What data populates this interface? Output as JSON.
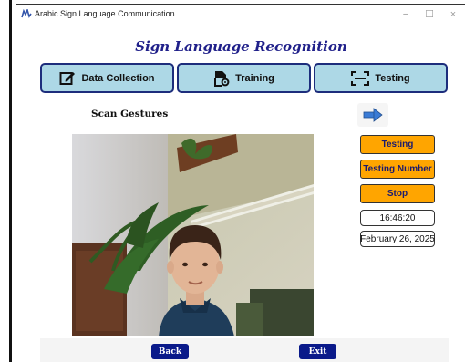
{
  "window": {
    "title": "Arabic Sign Language Communication",
    "controls": {
      "minimize": "−",
      "maximize": "☐",
      "close": "×"
    }
  },
  "page_title": "Sign Language Recognition",
  "tabs": [
    {
      "label": "Data Collection",
      "icon": "edit-icon"
    },
    {
      "label": "Training",
      "icon": "file-settings-icon"
    },
    {
      "label": "Testing",
      "icon": "scan-icon"
    }
  ],
  "scan_label": "Scan Gestures",
  "next_button": {
    "icon": "arrow-right-icon",
    "color": "#3a7bd5"
  },
  "side_panel": {
    "testing_label": "Testing",
    "testing_number_label": "Testing Number",
    "stop_label": "Stop",
    "time": "16:46:20",
    "date": "February 26, 2025"
  },
  "bottom": {
    "back_label": "Back",
    "exit_label": "Exit"
  },
  "colors": {
    "title": "#20208a",
    "tab_bg": "#add8e6",
    "tab_border": "#1d2d7c",
    "orange": "#ffa500",
    "nav_btn": "#0a1a8a"
  }
}
